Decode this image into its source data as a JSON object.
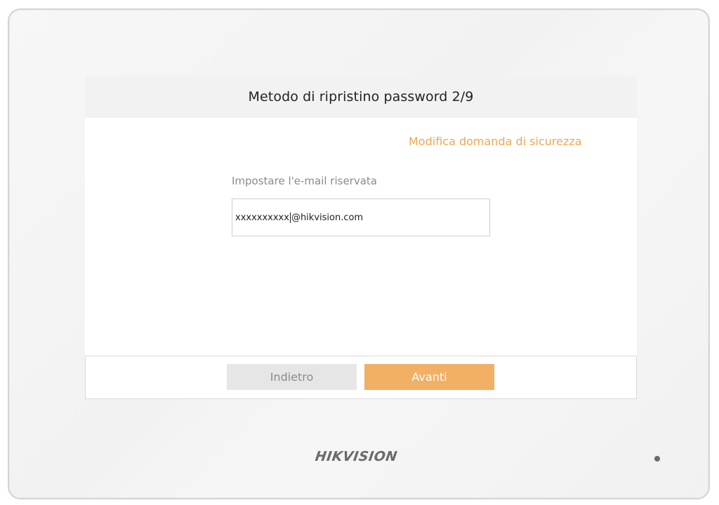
{
  "header": {
    "title": "Metodo di ripristino password 2/9"
  },
  "actions": {
    "change_security_question": "Modifica domanda di sicurezza"
  },
  "form": {
    "email_label": "Impostare l'e-mail riservata",
    "email_value_before_cursor": "xxxxxxxxxx",
    "email_value_after_cursor": "@hikvision.com"
  },
  "footer": {
    "back_label": "Indietro",
    "next_label": "Avanti"
  },
  "device": {
    "brand": "HIKVISION"
  },
  "colors": {
    "accent": "#f1b063",
    "link": "#f0a650",
    "secondary_button": "#e6e6e6"
  }
}
